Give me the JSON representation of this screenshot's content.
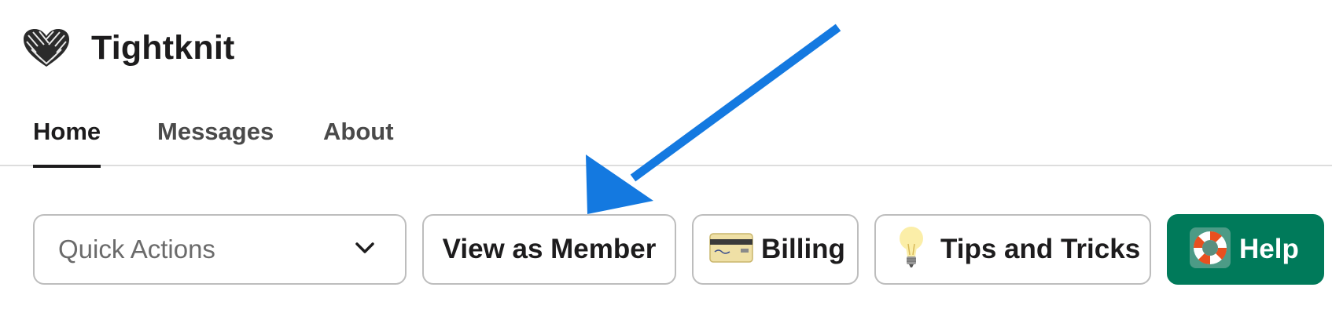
{
  "app": {
    "title": "Tightknit",
    "logo_icon": "knit-heart-icon"
  },
  "tabs": [
    {
      "label": "Home",
      "active": true
    },
    {
      "label": "Messages",
      "active": false
    },
    {
      "label": "About",
      "active": false
    }
  ],
  "toolbar": {
    "quick_actions": {
      "label": "Quick Actions",
      "icon": "chevron-down-icon"
    },
    "view_as_member": {
      "label": "View as Member"
    },
    "billing": {
      "label": "Billing",
      "icon": "credit-card-icon"
    },
    "tips": {
      "label": "Tips and Tricks",
      "icon": "lightbulb-icon"
    },
    "help": {
      "label": "Help",
      "icon": "lifebuoy-icon"
    }
  },
  "colors": {
    "help_button_bg": "#007a5a",
    "annotation_arrow": "#1479e0",
    "active_tab_underline": "#1d1c1d"
  }
}
